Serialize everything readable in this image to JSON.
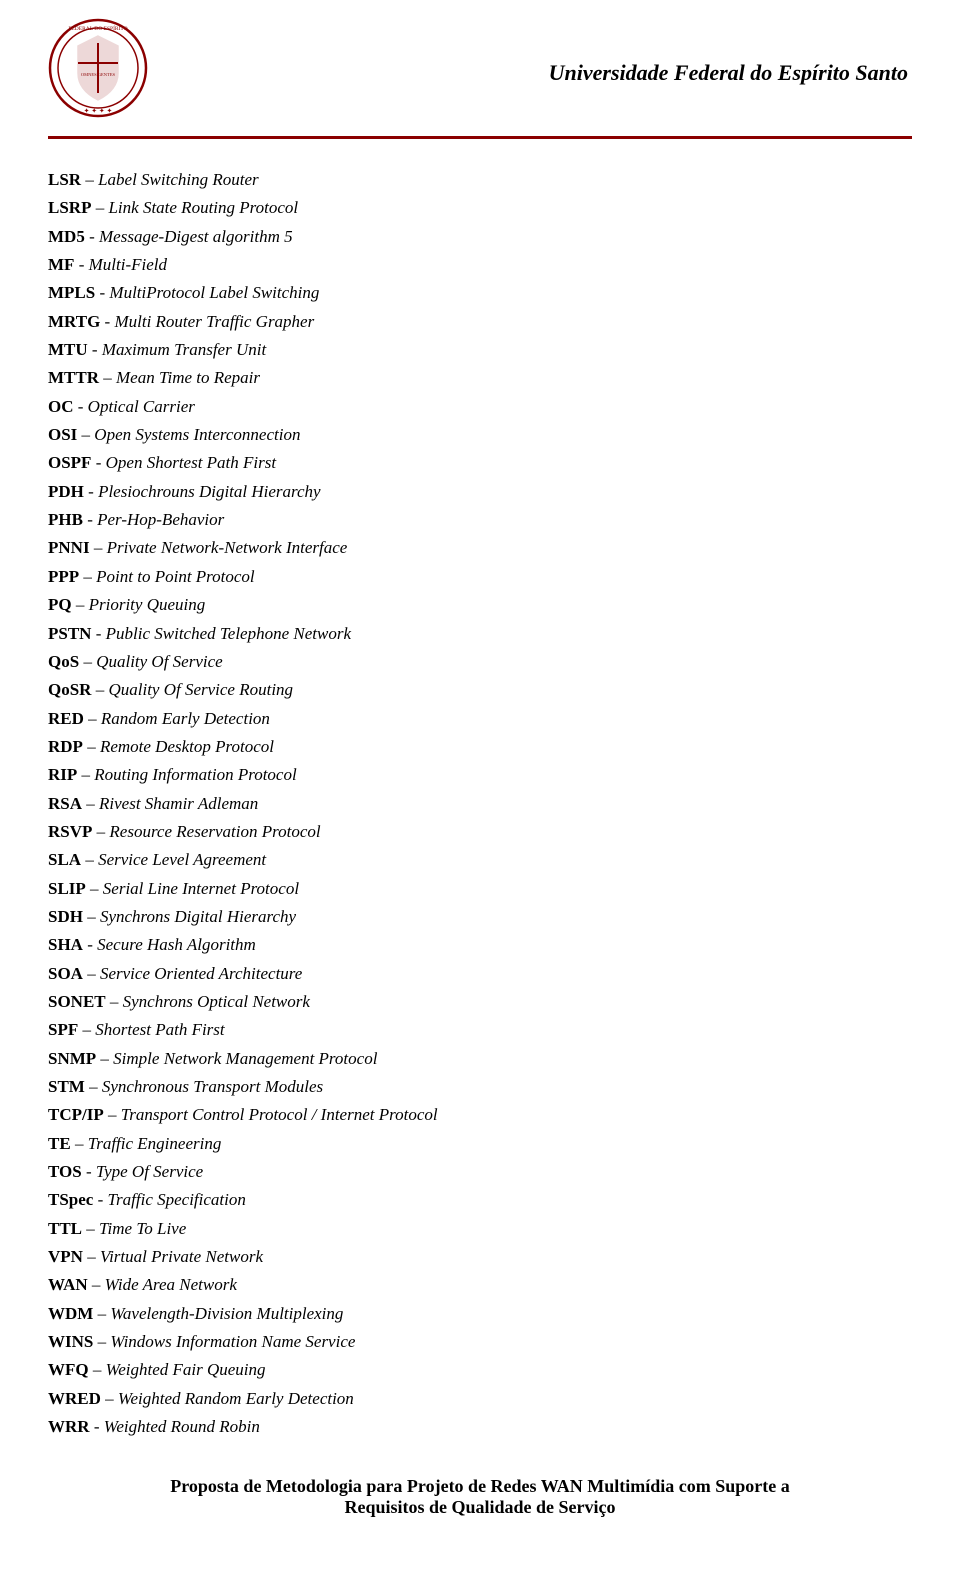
{
  "header": {
    "title": "Universidade Federal do Espírito Santo"
  },
  "entries": [
    {
      "abbr": "LSR",
      "sep": " – ",
      "def": "Label Switching Router"
    },
    {
      "abbr": "LSRP",
      "sep": " – ",
      "def": "Link State Routing Protocol"
    },
    {
      "abbr": "MD5",
      "sep": " - ",
      "def": "Message-Digest algorithm 5"
    },
    {
      "abbr": "MF",
      "sep": " - ",
      "def": "Multi-Field"
    },
    {
      "abbr": "MPLS",
      "sep": " - ",
      "def": "MultiProtocol Label Switching"
    },
    {
      "abbr": "MRTG",
      "sep": " - ",
      "def": "Multi Router Traffic Grapher"
    },
    {
      "abbr": "MTU",
      "sep": " - ",
      "def": "Maximum Transfer Unit"
    },
    {
      "abbr": "MTTR",
      "sep": " – ",
      "def": "Mean Time to Repair"
    },
    {
      "abbr": "OC",
      "sep": " - ",
      "def": "Optical Carrier"
    },
    {
      "abbr": "OSI",
      "sep": " – ",
      "def": "Open Systems Interconnection"
    },
    {
      "abbr": "OSPF",
      "sep": " - ",
      "def": "Open Shortest Path First"
    },
    {
      "abbr": "PDH",
      "sep": " - ",
      "def": "Plesiochrouns Digital Hierarchy"
    },
    {
      "abbr": "PHB",
      "sep": " - ",
      "def": "Per-Hop-Behavior"
    },
    {
      "abbr": "PNNI",
      "sep": " – ",
      "def": "Private Network-Network Interface"
    },
    {
      "abbr": "PPP",
      "sep": " – ",
      "def": "Point to Point Protocol"
    },
    {
      "abbr": "PQ",
      "sep": " – ",
      "def": "Priority Queuing"
    },
    {
      "abbr": "PSTN",
      "sep": " - ",
      "def": "Public Switched Telephone Network"
    },
    {
      "abbr": "QoS",
      "sep": " – ",
      "def": "Quality Of Service"
    },
    {
      "abbr": "QoSR",
      "sep": " – ",
      "def": "Quality Of Service Routing"
    },
    {
      "abbr": "RED",
      "sep": " – ",
      "def": "Random Early Detection"
    },
    {
      "abbr": "RDP",
      "sep": " – ",
      "def": "Remote Desktop Protocol"
    },
    {
      "abbr": "RIP",
      "sep": " – ",
      "def": "Routing Information Protocol"
    },
    {
      "abbr": "RSA",
      "sep": " – ",
      "def": "Rivest Shamir Adleman"
    },
    {
      "abbr": "RSVP",
      "sep": " – ",
      "def": "Resource Reservation Protocol"
    },
    {
      "abbr": "SLA",
      "sep": " – ",
      "def": "Service Level Agreement"
    },
    {
      "abbr": "SLIP",
      "sep": " – ",
      "def": "Serial Line Internet Protocol"
    },
    {
      "abbr": "SDH",
      "sep": " – ",
      "def": "Synchrons Digital Hierarchy"
    },
    {
      "abbr": "SHA",
      "sep": " - ",
      "def": "Secure Hash Algorithm"
    },
    {
      "abbr": "SOA",
      "sep": " – ",
      "def": "Service Oriented Architecture"
    },
    {
      "abbr": "SONET",
      "sep": " – ",
      "def": "Synchrons Optical Network"
    },
    {
      "abbr": "SPF",
      "sep": " – ",
      "def": "Shortest Path First"
    },
    {
      "abbr": "SNMP",
      "sep": " – ",
      "def": "Simple Network Management Protocol"
    },
    {
      "abbr": "STM",
      "sep": " – ",
      "def": "Synchronous Transport Modules"
    },
    {
      "abbr": "TCP/IP",
      "sep": " – ",
      "def": "Transport Control Protocol / Internet Protocol"
    },
    {
      "abbr": "TE",
      "sep": " – ",
      "def": "Traffic Engineering"
    },
    {
      "abbr": "TOS",
      "sep": " - ",
      "def": "Type Of Service"
    },
    {
      "abbr": "TSpec",
      "sep": " - ",
      "def": "Traffic Specification"
    },
    {
      "abbr": "TTL",
      "sep": " – ",
      "def": "Time To Live"
    },
    {
      "abbr": "VPN",
      "sep": " – ",
      "def": "Virtual Private Network"
    },
    {
      "abbr": "WAN",
      "sep": " – ",
      "def": "Wide Area Network"
    },
    {
      "abbr": "WDM",
      "sep": " – ",
      "def": "Wavelength-Division Multiplexing"
    },
    {
      "abbr": "WINS",
      "sep": " – ",
      "def": "Windows Information Name Service"
    },
    {
      "abbr": "WFQ",
      "sep": " – ",
      "def": "Weighted Fair Queuing"
    },
    {
      "abbr": "WRED",
      "sep": " – ",
      "def": "Weighted Random Early Detection"
    },
    {
      "abbr": "WRR",
      "sep": " - ",
      "def": "Weighted Round Robin"
    }
  ],
  "footer": {
    "line1": "Proposta de Metodologia para Projeto de Redes WAN Multimídia com Suporte a",
    "line2": "Requisitos de Qualidade de Serviço"
  }
}
